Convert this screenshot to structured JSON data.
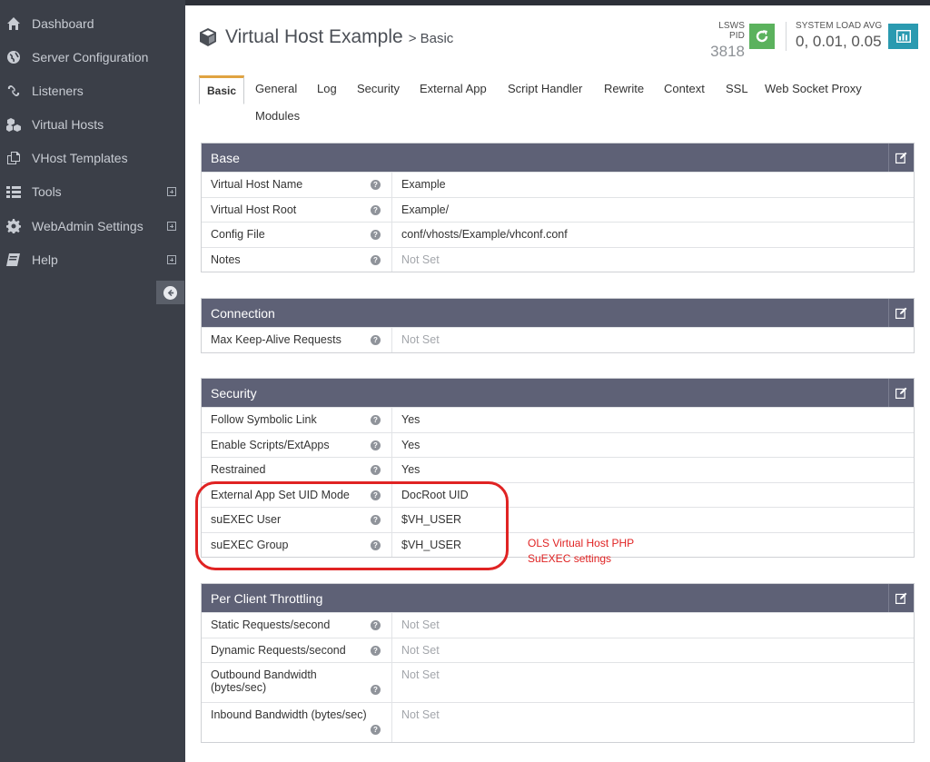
{
  "sidebar": {
    "items": [
      {
        "label": "Dashboard",
        "icon": "home-icon",
        "expandable": false
      },
      {
        "label": "Server Configuration",
        "icon": "globe-icon",
        "expandable": false
      },
      {
        "label": "Listeners",
        "icon": "link-icon",
        "expandable": false
      },
      {
        "label": "Virtual Hosts",
        "icon": "cubes-icon",
        "expandable": false
      },
      {
        "label": "VHost Templates",
        "icon": "copy-icon",
        "expandable": false
      },
      {
        "label": "Tools",
        "icon": "grid-icon",
        "expandable": true
      },
      {
        "label": "WebAdmin Settings",
        "icon": "gear-icon",
        "expandable": true
      },
      {
        "label": "Help",
        "icon": "book-icon",
        "expandable": true
      }
    ]
  },
  "header": {
    "title": "Virtual Host Example",
    "breadcrumb": "> Basic",
    "pid_label": "LSWS PID",
    "pid_value": "3818",
    "load_label": "SYSTEM LOAD AVG",
    "load_value": "0, 0.01, 0.05"
  },
  "tabs": [
    "Basic",
    "General",
    "Log",
    "Security",
    "External App",
    "Script Handler",
    "Rewrite",
    "Context",
    "SSL",
    "Web Socket Proxy",
    "Modules"
  ],
  "panels": {
    "base": {
      "title": "Base",
      "rows": [
        {
          "key": "Virtual Host Name",
          "value": "Example"
        },
        {
          "key": "Virtual Host Root",
          "value": "Example/"
        },
        {
          "key": "Config File",
          "value": "conf/vhosts/Example/vhconf.conf"
        },
        {
          "key": "Notes",
          "value": "Not Set"
        }
      ]
    },
    "connection": {
      "title": "Connection",
      "rows": [
        {
          "key": "Max Keep-Alive Requests",
          "value": "Not Set"
        }
      ]
    },
    "security": {
      "title": "Security",
      "rows": [
        {
          "key": "Follow Symbolic Link",
          "value": "Yes"
        },
        {
          "key": "Enable Scripts/ExtApps",
          "value": "Yes"
        },
        {
          "key": "Restrained",
          "value": "Yes"
        },
        {
          "key": "External App Set UID Mode",
          "value": "DocRoot UID"
        },
        {
          "key": "suEXEC User",
          "value": "$VH_USER"
        },
        {
          "key": "suEXEC Group",
          "value": "$VH_USER"
        }
      ]
    },
    "throttling": {
      "title": "Per Client Throttling",
      "rows": [
        {
          "key": "Static Requests/second",
          "value": "Not Set"
        },
        {
          "key": "Dynamic Requests/second",
          "value": "Not Set"
        },
        {
          "key": "Outbound Bandwidth (bytes/sec)",
          "value": "Not Set"
        },
        {
          "key": "Inbound Bandwidth (bytes/sec)",
          "value": "Not Set"
        }
      ]
    }
  },
  "annotation": {
    "line1": "OLS Virtual Host PHP",
    "line2": "SuEXEC settings"
  },
  "colors": {
    "sidebar_bg": "#3b3f48",
    "panel_header": "#5e6176",
    "restart_button": "#5bb25d",
    "chart_button": "#2a9ab0",
    "active_tab_accent": "#e0a341",
    "annotation_red": "#e02323"
  }
}
